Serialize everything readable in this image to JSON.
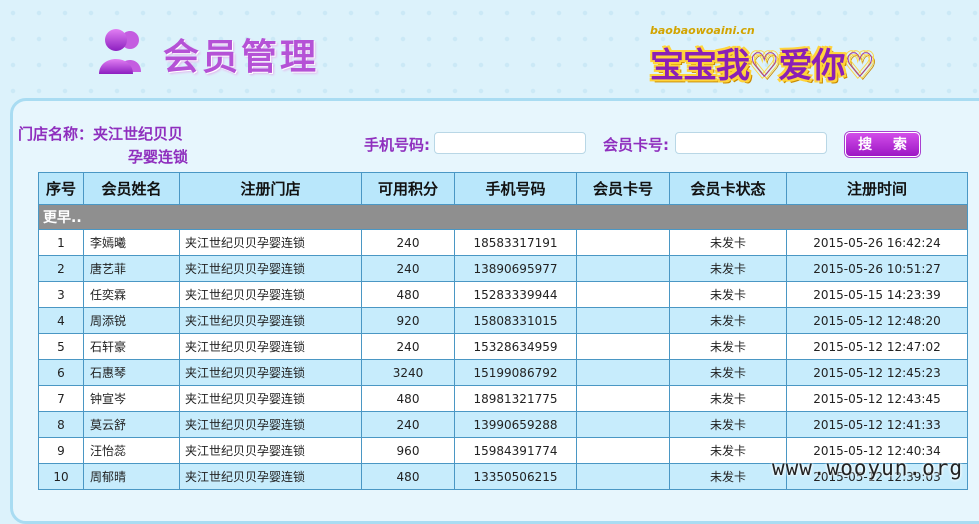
{
  "header": {
    "title": "会员管理",
    "logo_small": "baobaowoaini.cn",
    "logo_main": "宝宝我♡爱你♡"
  },
  "filters": {
    "store_label": "门店名称：",
    "store_name_1": "夹江世纪贝贝",
    "store_name_2": "孕婴连锁",
    "phone_label": "手机号码:",
    "phone_value": "",
    "card_label": "会员卡号:",
    "card_value": "",
    "search_label": "搜 索"
  },
  "table": {
    "columns": [
      "序号",
      "会员姓名",
      "注册门店",
      "可用积分",
      "手机号码",
      "会员卡号",
      "会员卡状态",
      "注册时间"
    ],
    "more_label": "更早..",
    "rows": [
      {
        "no": "1",
        "name": "李嫣曦",
        "store": "夹江世纪贝贝孕婴连锁",
        "points": "240",
        "phone": "18583317191",
        "card": "",
        "status": "未发卡",
        "time": "2015-05-26 16:42:24"
      },
      {
        "no": "2",
        "name": "唐艺菲",
        "store": "夹江世纪贝贝孕婴连锁",
        "points": "240",
        "phone": "13890695977",
        "card": "",
        "status": "未发卡",
        "time": "2015-05-26 10:51:27"
      },
      {
        "no": "3",
        "name": "任奕霖",
        "store": "夹江世纪贝贝孕婴连锁",
        "points": "480",
        "phone": "15283339944",
        "card": "",
        "status": "未发卡",
        "time": "2015-05-15 14:23:39"
      },
      {
        "no": "4",
        "name": "周添锐",
        "store": "夹江世纪贝贝孕婴连锁",
        "points": "920",
        "phone": "15808331015",
        "card": "",
        "status": "未发卡",
        "time": "2015-05-12 12:48:20"
      },
      {
        "no": "5",
        "name": "石轩豪",
        "store": "夹江世纪贝贝孕婴连锁",
        "points": "240",
        "phone": "15328634959",
        "card": "",
        "status": "未发卡",
        "time": "2015-05-12 12:47:02"
      },
      {
        "no": "6",
        "name": "石惠琴",
        "store": "夹江世纪贝贝孕婴连锁",
        "points": "3240",
        "phone": "15199086792",
        "card": "",
        "status": "未发卡",
        "time": "2015-05-12 12:45:23"
      },
      {
        "no": "7",
        "name": "钟宣岑",
        "store": "夹江世纪贝贝孕婴连锁",
        "points": "480",
        "phone": "18981321775",
        "card": "",
        "status": "未发卡",
        "time": "2015-05-12 12:43:45"
      },
      {
        "no": "8",
        "name": "莫云舒",
        "store": "夹江世纪贝贝孕婴连锁",
        "points": "240",
        "phone": "13990659288",
        "card": "",
        "status": "未发卡",
        "time": "2015-05-12 12:41:33"
      },
      {
        "no": "9",
        "name": "汪怡蕊",
        "store": "夹江世纪贝贝孕婴连锁",
        "points": "960",
        "phone": "15984391774",
        "card": "",
        "status": "未发卡",
        "time": "2015-05-12 12:40:34"
      },
      {
        "no": "10",
        "name": "周郁晴",
        "store": "夹江世纪贝贝孕婴连锁",
        "points": "480",
        "phone": "13350506215",
        "card": "",
        "status": "未发卡",
        "time": "2015-05-12 12:39:03"
      }
    ]
  },
  "watermark": "www.wooyun.org",
  "colors": {
    "title": "#b552d6",
    "label": "#8f2fbe",
    "header_bg": "#b9e7fb",
    "row_alt": "#c7ecfc",
    "border": "#4a97c4"
  }
}
